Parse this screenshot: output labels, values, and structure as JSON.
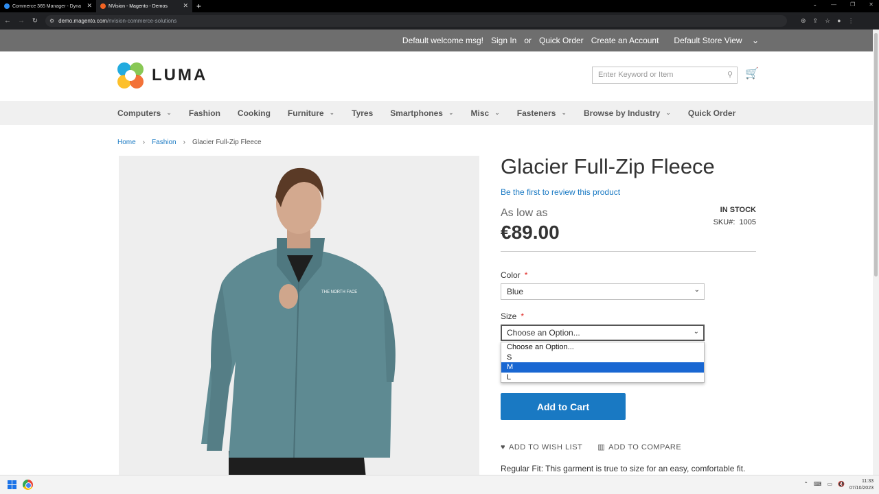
{
  "browser": {
    "tabs": [
      {
        "title": "Commerce 365 Manager - Dyna",
        "active": false
      },
      {
        "title": "NVision - Magento - Demos",
        "active": true
      }
    ],
    "new_tab": "+",
    "url_host": "demo.magento.com",
    "url_path": "/nvision-commerce-solutions"
  },
  "panel": {
    "welcome": "Default welcome msg!",
    "sign_in": "Sign In",
    "or": "or",
    "quick_order": "Quick Order",
    "create_account": "Create an Account",
    "store_view": "Default Store View"
  },
  "header": {
    "logo_text": "LUMA",
    "search_placeholder": "Enter Keyword or Item"
  },
  "nav": {
    "items": [
      {
        "label": "Computers",
        "dropdown": true
      },
      {
        "label": "Fashion",
        "dropdown": false
      },
      {
        "label": "Cooking",
        "dropdown": false
      },
      {
        "label": "Furniture",
        "dropdown": true
      },
      {
        "label": "Tyres",
        "dropdown": false
      },
      {
        "label": "Smartphones",
        "dropdown": true
      },
      {
        "label": "Misc",
        "dropdown": true
      },
      {
        "label": "Fasteners",
        "dropdown": true
      },
      {
        "label": "Browse by Industry",
        "dropdown": true
      },
      {
        "label": "Quick Order",
        "dropdown": false
      }
    ]
  },
  "breadcrumbs": [
    "Home",
    "Fashion",
    "Glacier Full-Zip Fleece"
  ],
  "product": {
    "title": "Glacier Full-Zip Fleece",
    "review_link": "Be the first to review this product",
    "as_low_as": "As low as",
    "price": "€89.00",
    "stock": "IN STOCK",
    "sku_label": "SKU#:",
    "sku": "1005",
    "color_label": "Color",
    "color_value": "Blue",
    "size_label": "Size",
    "size_value": "Choose an Option...",
    "size_options": [
      "Choose an Option...",
      "S",
      "M",
      "L"
    ],
    "size_highlighted": "M",
    "add_to_cart": "Add to Cart",
    "wishlist": "ADD TO WISH LIST",
    "compare": "ADD TO COMPARE",
    "description": "Regular Fit: This garment is true to size for an easy, comfortable fit.",
    "jacket_brand": "THE NORTH FACE"
  },
  "colors": {
    "accent": "#1979c3",
    "panel": "#6e6e6e",
    "jacket": "#5e8a92"
  },
  "taskbar": {
    "time": "11:33",
    "date": "07/10/2023"
  }
}
